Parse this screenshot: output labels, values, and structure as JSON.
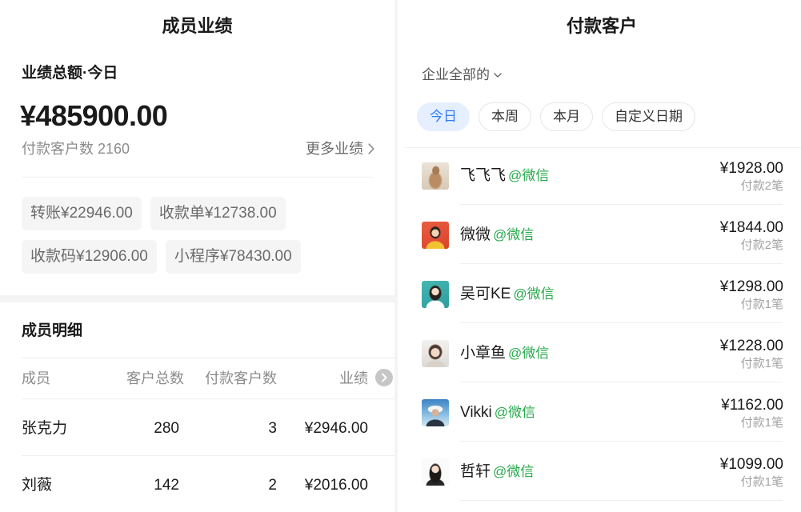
{
  "colors": {
    "accent_blue": "#2f7cf6",
    "selected_chip_bg": "#e5efff",
    "wechat_green": "#27a94b",
    "tag_bg": "#f5f5f5",
    "text_primary": "#1a1a1a",
    "text_secondary": "#8c8c8c"
  },
  "icons": {
    "more_link": "chevron-right-icon",
    "scope_filter": "chevron-down-icon",
    "table_more": "circle-chevron-right-icon"
  },
  "member_performance": {
    "title": "成员业绩",
    "summary": {
      "label": "业绩总额·今日",
      "total": "¥485900.00",
      "paying_customers_label": "付款客户数",
      "paying_customers_value": "2160",
      "more_link": "更多业绩"
    },
    "payment_channels": [
      {
        "label": "转账",
        "amount": "¥22946.00"
      },
      {
        "label": "收款单",
        "amount": "¥12738.00"
      },
      {
        "label": "收款码",
        "amount": "¥12906.00"
      },
      {
        "label": "小程序",
        "amount": "¥78430.00"
      }
    ],
    "member_details": {
      "title": "成员明细",
      "columns": [
        "成员",
        "客户总数",
        "付款客户数",
        "业绩"
      ],
      "rows": [
        {
          "name": "张克力",
          "total_customers": "280",
          "paying_customers": "3",
          "performance": "¥2946.00"
        },
        {
          "name": "刘薇",
          "total_customers": "142",
          "paying_customers": "2",
          "performance": "¥2016.00"
        }
      ]
    }
  },
  "paying_customers": {
    "title": "付款客户",
    "scope_filter": "企业全部的",
    "date_filters": [
      {
        "label": "今日",
        "selected": true
      },
      {
        "label": "本周",
        "selected": false
      },
      {
        "label": "本月",
        "selected": false
      },
      {
        "label": "自定义日期",
        "selected": false
      }
    ],
    "customers": [
      {
        "name": "飞飞飞",
        "source": "@微信",
        "amount": "¥1928.00",
        "payments": "付款2笔"
      },
      {
        "name": "微微",
        "source": "@微信",
        "amount": "¥1844.00",
        "payments": "付款2笔"
      },
      {
        "name": "吴可KE",
        "source": "@微信",
        "amount": "¥1298.00",
        "payments": "付款1笔"
      },
      {
        "name": "小章鱼",
        "source": "@微信",
        "amount": "¥1228.00",
        "payments": "付款1笔"
      },
      {
        "name": "Vikki",
        "source": "@微信",
        "amount": "¥1162.00",
        "payments": "付款1笔"
      },
      {
        "name": "哲轩",
        "source": "@微信",
        "amount": "¥1099.00",
        "payments": "付款1笔"
      }
    ]
  }
}
